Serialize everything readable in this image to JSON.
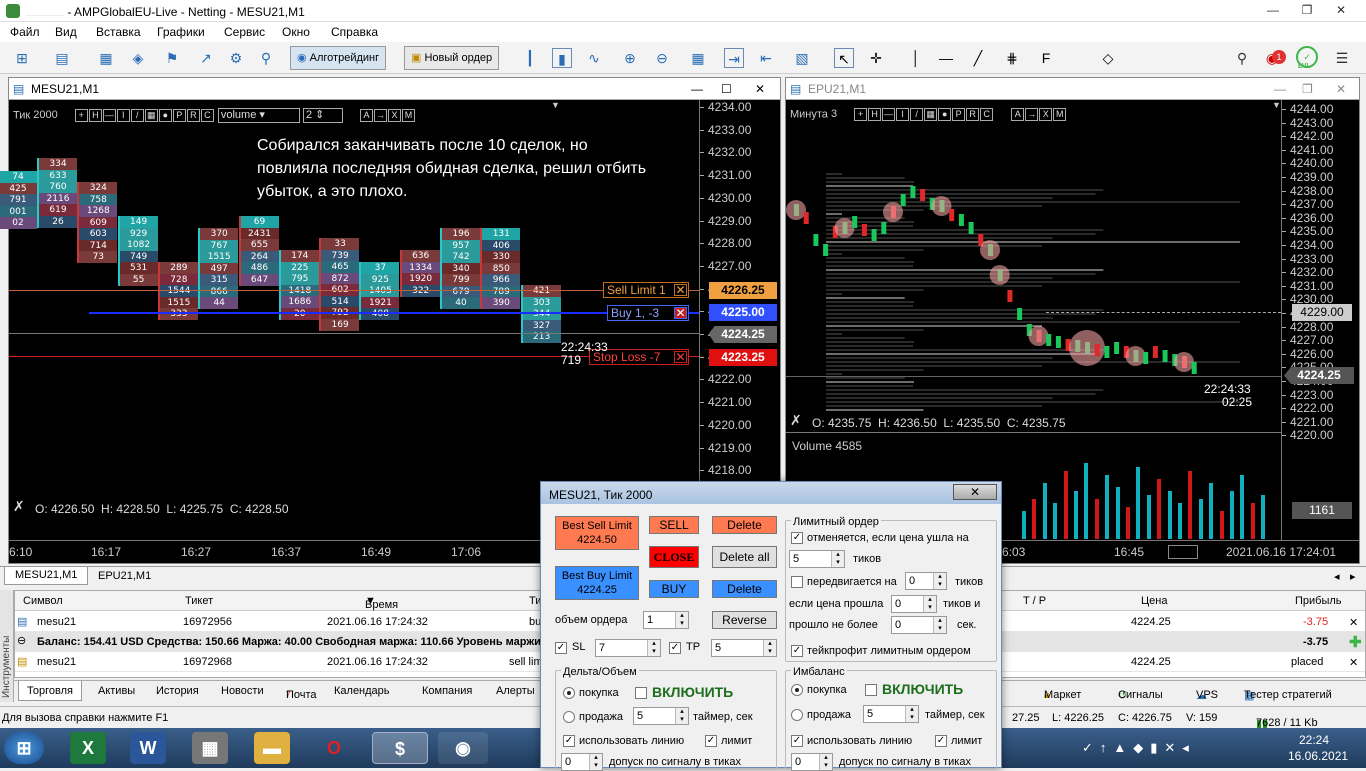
{
  "window": {
    "title": "AMPGlobalEU-Live - Netting - MESU21,M1"
  },
  "menu": [
    "Файл",
    "Вид",
    "Вставка",
    "Графики",
    "Сервис",
    "Окно",
    "Справка"
  ],
  "toolbar": {
    "algo_label": "Алготрейдинг",
    "neworder_label": "Новый ордер",
    "notify_count": "1",
    "lvl_label": "LVL"
  },
  "chart1": {
    "title": "MESU21,M1",
    "mode": "Тик",
    "ticks": "2000",
    "volume_select": "volume",
    "volume_num": "2",
    "annotation": [
      "Собирался заканчивать после 10 сделок, но",
      "повлияла последняя обидная сделка, решил отбить",
      "убыток, а это плохо."
    ],
    "ohlc": "O: 4226.50  H: 4228.50  L: 4225.75  C: 4228.50",
    "price_axis": [
      "4234.00",
      "4233.00",
      "4232.00",
      "4231.00",
      "4230.00",
      "4229.00",
      "4228.00",
      "4227.00",
      "4226.00",
      "4225.00",
      "4224.00",
      "4223.00",
      "4222.00",
      "4221.00",
      "4220.00",
      "4219.00",
      "4218.00"
    ],
    "time_axis": [
      "6:10",
      "16:17",
      "16:27",
      "16:37",
      "16:49",
      "17:06"
    ],
    "clusters": [
      [
        "74",
        "425",
        "791",
        "001",
        "02"
      ],
      [
        "334",
        "633",
        "760",
        "2116",
        "619",
        "26"
      ],
      [
        "324",
        "758",
        "1268",
        "609",
        "603",
        "714",
        "73"
      ],
      [
        "149",
        "929",
        "1082",
        "749",
        "531",
        "55"
      ],
      [
        "289",
        "728",
        "1544",
        "1515",
        "333"
      ],
      [
        "370",
        "767",
        "1515",
        "497",
        "315",
        "866",
        "44"
      ],
      [
        "69",
        "2431",
        "655",
        "264",
        "486",
        "647"
      ],
      [
        "174",
        "225",
        "795",
        "1418",
        "1686",
        "20"
      ],
      [
        "33",
        "739",
        "465",
        "872",
        "602",
        "514",
        "792",
        "169"
      ],
      [
        "37",
        "925",
        "1405",
        "1921",
        "408"
      ],
      [
        "636",
        "1334",
        "1920",
        "322"
      ],
      [
        "196",
        "957",
        "742",
        "340",
        "799",
        "679",
        "40"
      ],
      [
        "131",
        "406",
        "330",
        "850",
        "966",
        "789",
        "390"
      ],
      [
        "421",
        "303",
        "344",
        "327",
        "213"
      ]
    ],
    "sell_limit_label": "Sell Limit  1",
    "sell_limit_price": "4226.25",
    "buy_label": "Buy  1,  -3",
    "buy_price": "4225.00",
    "current_price": "4224.25",
    "stop_loss_label": "Stop Loss  -7",
    "stop_loss_price": "4223.25",
    "timer_time": "22:24:33",
    "timer_val": "719"
  },
  "chart2": {
    "title": "EPU21,M1",
    "mode": "Минута",
    "mode_num": "3",
    "ohlc": "O: 4235.75  H: 4236.50  L: 4235.50  C: 4235.75",
    "price_axis": [
      "4244.00",
      "4243.00",
      "4242.00",
      "4241.00",
      "4240.00",
      "4239.00",
      "4238.00",
      "4237.00",
      "4236.00",
      "4235.00",
      "4234.00",
      "4233.00",
      "4232.00",
      "4231.00",
      "4230.00",
      "4229.00",
      "4228.00",
      "4227.00",
      "4226.00",
      "4225.00",
      "4224.00",
      "4223.00",
      "4222.00",
      "4221.00",
      "4220.00"
    ],
    "highlight_price": "4229.00",
    "current_price": "4224.25",
    "timer_time": "22:24:33",
    "timer_val": "02:25",
    "volume_label": "Volume 4585",
    "volume_value": "1161",
    "time_axis": [
      "6:03",
      "16:45"
    ],
    "date_label": "2021.06.16 17:24:01",
    "volumes": [
      0.35,
      0.5,
      0.7,
      0.45,
      0.85,
      0.6,
      0.95,
      0.5,
      0.8,
      0.65,
      0.4,
      0.9,
      0.55,
      0.75,
      0.6,
      0.45,
      0.85,
      0.5,
      0.7,
      0.35,
      0.6,
      0.8,
      0.45,
      0.55
    ]
  },
  "chart_tabs": [
    "MESU21,M1",
    "EPU21,M1"
  ],
  "terminal": {
    "headers": {
      "symbol": "Символ",
      "ticket": "Тикет",
      "time": "Время",
      "type": "Ти",
      "tp": "T / P",
      "price": "Цена",
      "profit": "Прибыль"
    },
    "rows": [
      {
        "symbol": "mesu21",
        "ticket": "16972956",
        "time": "2021.06.16 17:24:32",
        "type": "bu",
        "price": "4224.25",
        "profit": "-3.75"
      },
      {
        "symbol": "mesu21",
        "ticket": "16972968",
        "time": "2021.06.16 17:24:32",
        "type": "sell lim",
        "price": "4224.25",
        "profit": "placed"
      }
    ],
    "balance_line": "Баланс: 154.41 USD  Средства: 150.66  Маржа: 40.00  Свободная маржа: 110.66  Уровень маржи",
    "balance_profit": "-3.75",
    "side_tab": "Инструменты"
  },
  "bottom_tabs": [
    "Торговля",
    "Активы",
    "История",
    "Новости",
    "Почта",
    "Календарь",
    "Компания",
    "Алерты"
  ],
  "mail_count": "7",
  "bottom_right": [
    "Маркет",
    "Сигналы",
    "VPS",
    "Тестер стратегий"
  ],
  "status": {
    "help": "Для вызова справки нажмите F1",
    "h": "27.25",
    "l": "L: 4226.25",
    "c": "C: 4226.75",
    "v": "V: 159",
    "net": "7628 / 11 Kb"
  },
  "taskbar": {
    "time": "22:24",
    "date": "16.06.2021"
  },
  "dialog": {
    "title": "MESU21, Тик  2000",
    "best_sell_label": "Best Sell Limit",
    "best_sell_price": "4224.50",
    "best_buy_label": "Best Buy Limit",
    "best_buy_price": "4224.25",
    "sell": "SELL",
    "close": "CLOSE",
    "buy": "BUY",
    "delete": "Delete",
    "delete_all": "Delete all",
    "reverse": "Reverse",
    "volume_label": "объем ордера",
    "volume_val": "1",
    "sl_label": "SL",
    "sl_val": "7",
    "tp_label": "TP",
    "tp_val": "5",
    "limit_group": "Лимитный ордер",
    "cancel_if": "отменяется, если цена ушла на",
    "ticks_val1": "5",
    "ticks": "тиков",
    "moves_by": "передвигается на",
    "moves_val": "0",
    "ticks2": "тиков",
    "if_price": "если цена прошла",
    "if_price_val": "0",
    "ticks_and": "тиков и",
    "passed_max": "прошло не более",
    "passed_val": "0",
    "sec": "сек.",
    "tp_limit": "тейкпрофит лимитным ордером",
    "delta_group": "Дельта/Объем",
    "imb_group": "Имбаланс",
    "buy_opt": "покупка",
    "enable": "ВКЛЮЧИТЬ",
    "sell_opt": "продажа",
    "timer_val": "5",
    "timer_label": "таймер, сек",
    "use_line": "использовать линию",
    "limit": "лимит",
    "tolerance_val": "0",
    "tolerance": "допуск по сигналу в тиках",
    "imb_timer_val": "5",
    "imb_tol_val": "0"
  }
}
